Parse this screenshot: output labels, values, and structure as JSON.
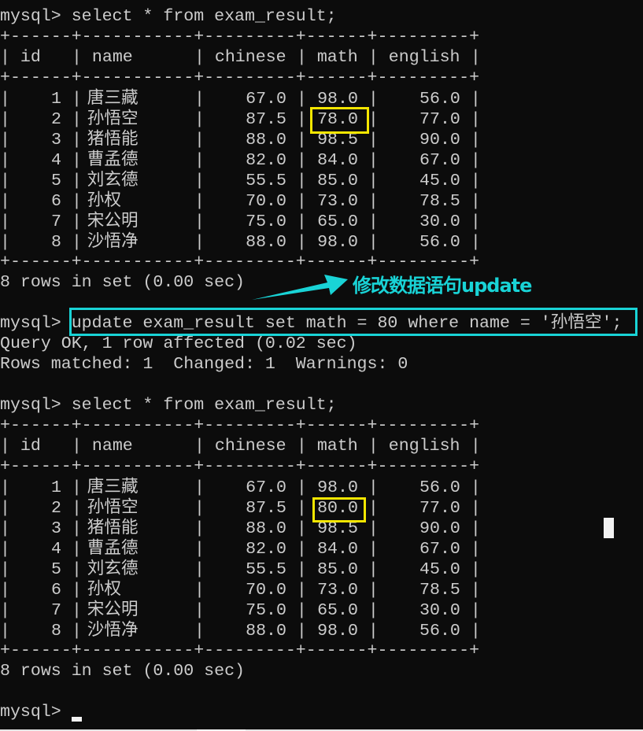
{
  "prompt": "mysql> ",
  "blocks": {
    "q1": {
      "command": "select * from exam_result;",
      "border": "+------+-----------+---------+------+---------+",
      "header": [
        "id",
        "name",
        "chinese",
        "math",
        "english"
      ],
      "rows": [
        [
          "1",
          "唐三藏",
          "67.0",
          "98.0",
          "56.0"
        ],
        [
          "2",
          "孙悟空",
          "87.5",
          "78.0",
          "77.0"
        ],
        [
          "3",
          "猪悟能",
          "88.0",
          "98.5",
          "90.0"
        ],
        [
          "4",
          "曹孟德",
          "82.0",
          "84.0",
          "67.0"
        ],
        [
          "5",
          "刘玄德",
          "55.5",
          "85.0",
          "45.0"
        ],
        [
          "6",
          "孙权",
          "70.0",
          "73.0",
          "78.5"
        ],
        [
          "7",
          "宋公明",
          "75.0",
          "65.0",
          "30.0"
        ],
        [
          "8",
          "沙悟净",
          "88.0",
          "98.0",
          "56.0"
        ]
      ],
      "footer": "8 rows in set (0.00 sec)",
      "highlighted_cell": "78.0"
    },
    "update": {
      "command": "update exam_result set math = 80 where name = '孙悟空';",
      "result_line1": "Query OK, 1 row affected (0.02 sec)",
      "result_line2": "Rows matched: 1  Changed: 1  Warnings: 0"
    },
    "q2": {
      "command": "select * from exam_result;",
      "border": "+------+-----------+---------+------+---------+",
      "header": [
        "id",
        "name",
        "chinese",
        "math",
        "english"
      ],
      "rows": [
        [
          "1",
          "唐三藏",
          "67.0",
          "98.0",
          "56.0"
        ],
        [
          "2",
          "孙悟空",
          "87.5",
          "80.0",
          "77.0"
        ],
        [
          "3",
          "猪悟能",
          "88.0",
          "98.5",
          "90.0"
        ],
        [
          "4",
          "曹孟德",
          "82.0",
          "84.0",
          "67.0"
        ],
        [
          "5",
          "刘玄德",
          "55.5",
          "85.0",
          "45.0"
        ],
        [
          "6",
          "孙权",
          "70.0",
          "73.0",
          "78.5"
        ],
        [
          "7",
          "宋公明",
          "75.0",
          "65.0",
          "30.0"
        ],
        [
          "8",
          "沙悟净",
          "88.0",
          "98.0",
          "56.0"
        ]
      ],
      "footer": "8 rows in set (0.00 sec)",
      "highlighted_cell": "80.0"
    }
  },
  "annotation": {
    "label": "修改数据语句update",
    "color": "#19d3d6"
  },
  "colors": {
    "background": "#0c0c0c",
    "text": "#cccccc",
    "highlight_yellow": "#f5e600",
    "highlight_cyan": "#19d3d6"
  }
}
